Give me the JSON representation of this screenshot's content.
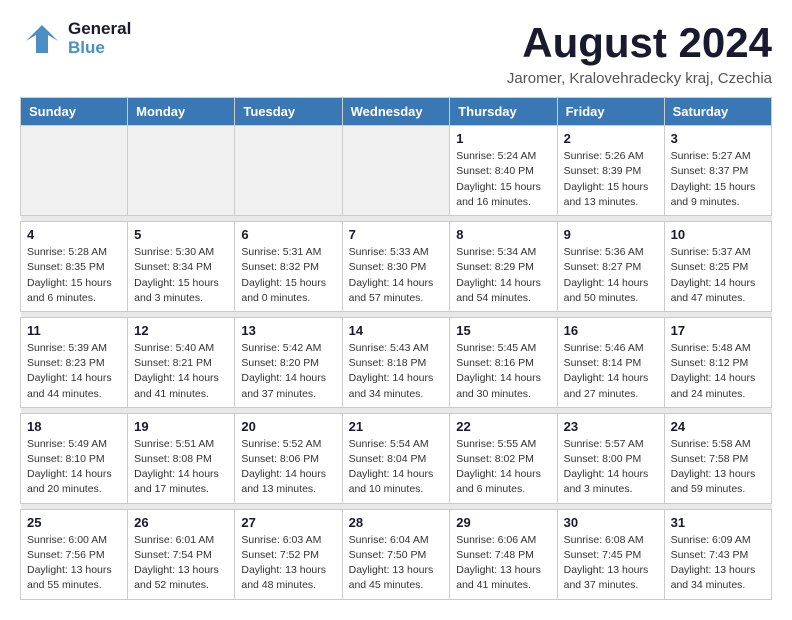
{
  "header": {
    "logo_general": "General",
    "logo_blue": "Blue",
    "month_title": "August 2024",
    "location": "Jaromer, Kralovehradecky kraj, Czechia"
  },
  "weekdays": [
    "Sunday",
    "Monday",
    "Tuesday",
    "Wednesday",
    "Thursday",
    "Friday",
    "Saturday"
  ],
  "weeks": [
    [
      {
        "day": "",
        "info": ""
      },
      {
        "day": "",
        "info": ""
      },
      {
        "day": "",
        "info": ""
      },
      {
        "day": "",
        "info": ""
      },
      {
        "day": "1",
        "info": "Sunrise: 5:24 AM\nSunset: 8:40 PM\nDaylight: 15 hours\nand 16 minutes."
      },
      {
        "day": "2",
        "info": "Sunrise: 5:26 AM\nSunset: 8:39 PM\nDaylight: 15 hours\nand 13 minutes."
      },
      {
        "day": "3",
        "info": "Sunrise: 5:27 AM\nSunset: 8:37 PM\nDaylight: 15 hours\nand 9 minutes."
      }
    ],
    [
      {
        "day": "4",
        "info": "Sunrise: 5:28 AM\nSunset: 8:35 PM\nDaylight: 15 hours\nand 6 minutes."
      },
      {
        "day": "5",
        "info": "Sunrise: 5:30 AM\nSunset: 8:34 PM\nDaylight: 15 hours\nand 3 minutes."
      },
      {
        "day": "6",
        "info": "Sunrise: 5:31 AM\nSunset: 8:32 PM\nDaylight: 15 hours\nand 0 minutes."
      },
      {
        "day": "7",
        "info": "Sunrise: 5:33 AM\nSunset: 8:30 PM\nDaylight: 14 hours\nand 57 minutes."
      },
      {
        "day": "8",
        "info": "Sunrise: 5:34 AM\nSunset: 8:29 PM\nDaylight: 14 hours\nand 54 minutes."
      },
      {
        "day": "9",
        "info": "Sunrise: 5:36 AM\nSunset: 8:27 PM\nDaylight: 14 hours\nand 50 minutes."
      },
      {
        "day": "10",
        "info": "Sunrise: 5:37 AM\nSunset: 8:25 PM\nDaylight: 14 hours\nand 47 minutes."
      }
    ],
    [
      {
        "day": "11",
        "info": "Sunrise: 5:39 AM\nSunset: 8:23 PM\nDaylight: 14 hours\nand 44 minutes."
      },
      {
        "day": "12",
        "info": "Sunrise: 5:40 AM\nSunset: 8:21 PM\nDaylight: 14 hours\nand 41 minutes."
      },
      {
        "day": "13",
        "info": "Sunrise: 5:42 AM\nSunset: 8:20 PM\nDaylight: 14 hours\nand 37 minutes."
      },
      {
        "day": "14",
        "info": "Sunrise: 5:43 AM\nSunset: 8:18 PM\nDaylight: 14 hours\nand 34 minutes."
      },
      {
        "day": "15",
        "info": "Sunrise: 5:45 AM\nSunset: 8:16 PM\nDaylight: 14 hours\nand 30 minutes."
      },
      {
        "day": "16",
        "info": "Sunrise: 5:46 AM\nSunset: 8:14 PM\nDaylight: 14 hours\nand 27 minutes."
      },
      {
        "day": "17",
        "info": "Sunrise: 5:48 AM\nSunset: 8:12 PM\nDaylight: 14 hours\nand 24 minutes."
      }
    ],
    [
      {
        "day": "18",
        "info": "Sunrise: 5:49 AM\nSunset: 8:10 PM\nDaylight: 14 hours\nand 20 minutes."
      },
      {
        "day": "19",
        "info": "Sunrise: 5:51 AM\nSunset: 8:08 PM\nDaylight: 14 hours\nand 17 minutes."
      },
      {
        "day": "20",
        "info": "Sunrise: 5:52 AM\nSunset: 8:06 PM\nDaylight: 14 hours\nand 13 minutes."
      },
      {
        "day": "21",
        "info": "Sunrise: 5:54 AM\nSunset: 8:04 PM\nDaylight: 14 hours\nand 10 minutes."
      },
      {
        "day": "22",
        "info": "Sunrise: 5:55 AM\nSunset: 8:02 PM\nDaylight: 14 hours\nand 6 minutes."
      },
      {
        "day": "23",
        "info": "Sunrise: 5:57 AM\nSunset: 8:00 PM\nDaylight: 14 hours\nand 3 minutes."
      },
      {
        "day": "24",
        "info": "Sunrise: 5:58 AM\nSunset: 7:58 PM\nDaylight: 13 hours\nand 59 minutes."
      }
    ],
    [
      {
        "day": "25",
        "info": "Sunrise: 6:00 AM\nSunset: 7:56 PM\nDaylight: 13 hours\nand 55 minutes."
      },
      {
        "day": "26",
        "info": "Sunrise: 6:01 AM\nSunset: 7:54 PM\nDaylight: 13 hours\nand 52 minutes."
      },
      {
        "day": "27",
        "info": "Sunrise: 6:03 AM\nSunset: 7:52 PM\nDaylight: 13 hours\nand 48 minutes."
      },
      {
        "day": "28",
        "info": "Sunrise: 6:04 AM\nSunset: 7:50 PM\nDaylight: 13 hours\nand 45 minutes."
      },
      {
        "day": "29",
        "info": "Sunrise: 6:06 AM\nSunset: 7:48 PM\nDaylight: 13 hours\nand 41 minutes."
      },
      {
        "day": "30",
        "info": "Sunrise: 6:08 AM\nSunset: 7:45 PM\nDaylight: 13 hours\nand 37 minutes."
      },
      {
        "day": "31",
        "info": "Sunrise: 6:09 AM\nSunset: 7:43 PM\nDaylight: 13 hours\nand 34 minutes."
      }
    ]
  ]
}
